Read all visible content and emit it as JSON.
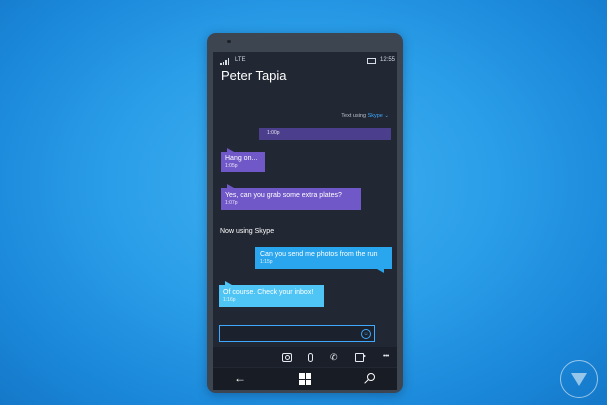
{
  "status": {
    "network": "LTE",
    "time": "12:55"
  },
  "contact": {
    "name": "Peter Tapia"
  },
  "text_using": {
    "label": "Text using",
    "service": "Skype",
    "chevron": "⌄"
  },
  "messages": [
    {
      "text": "",
      "time": "1:00p",
      "direction": "sent",
      "color": "#4b3e8c"
    },
    {
      "text": "Hang on...",
      "time": "1:05p",
      "direction": "received",
      "color": "#7158c8"
    },
    {
      "text": "Yes, can you grab some extra plates?",
      "time": "1:07p",
      "direction": "received",
      "color": "#7158c8"
    },
    {
      "text": "Can you send me photos from the run",
      "time": "1:15p",
      "direction": "sent",
      "color": "#29a6ee"
    },
    {
      "text": "Of course. Check your inbox!",
      "time": "1:16p",
      "direction": "received",
      "color": "#4fc5f5"
    }
  ],
  "separator": {
    "label": "Now using Skype"
  },
  "compose": {
    "placeholder": ""
  },
  "appbar": {
    "icons": [
      "camera-icon",
      "attach-icon",
      "phone-call-icon",
      "video-call-icon",
      "more-icon"
    ],
    "more": "•••",
    "phone_glyph": "✆"
  },
  "nav": {
    "back_glyph": "←"
  },
  "colors": {
    "background": "#2a9ee8",
    "accent": "#3fa9ff",
    "screen": "#212733"
  }
}
